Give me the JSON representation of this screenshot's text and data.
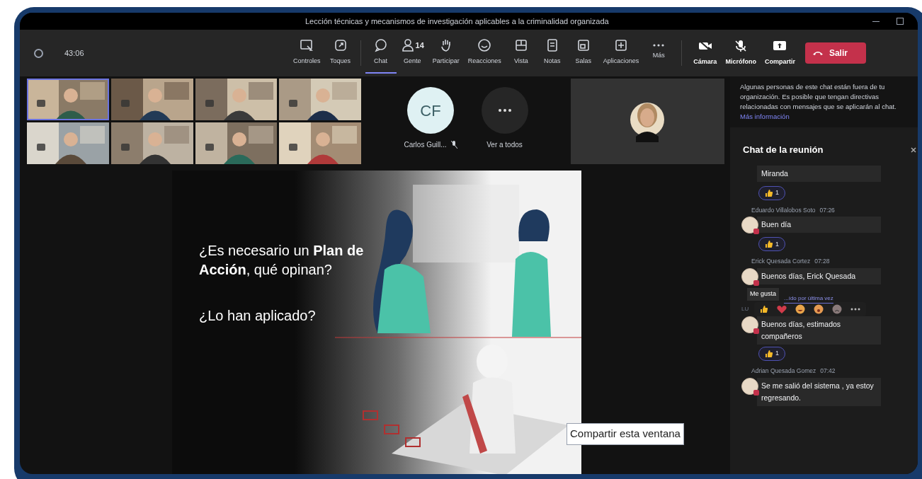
{
  "window": {
    "title": "Lección técnicas y mecanismos de investigación aplicables a la criminalidad organizada"
  },
  "toolbar": {
    "timer": "43:06",
    "items": [
      {
        "kind": "controls",
        "label": "Controles",
        "selected": false
      },
      {
        "kind": "toques",
        "label": "Toques",
        "selected": false
      },
      {
        "kind": "chat",
        "label": "Chat",
        "selected": true
      },
      {
        "kind": "people",
        "label": "Gente",
        "count": "14",
        "selected": false
      },
      {
        "kind": "hand",
        "label": "Participar",
        "selected": false
      },
      {
        "kind": "smile",
        "label": "Reacciones",
        "selected": false
      },
      {
        "kind": "view",
        "label": "Vista",
        "selected": false
      },
      {
        "kind": "notes",
        "label": "Notas",
        "selected": false
      },
      {
        "kind": "rooms",
        "label": "Salas",
        "selected": false
      },
      {
        "kind": "apps",
        "label": "Aplicaciones",
        "selected": false
      },
      {
        "kind": "more",
        "label": "Más",
        "selected": false
      }
    ],
    "devices": [
      {
        "kind": "camera",
        "label": "Cámara"
      },
      {
        "kind": "mic",
        "label": "Micrófono"
      },
      {
        "kind": "share",
        "label": "Compartir"
      }
    ],
    "leave": "Salir"
  },
  "video_tiles": [
    {
      "kind": "picture",
      "selected": true
    },
    {
      "kind": "picture",
      "selected": false
    },
    {
      "kind": "picture",
      "selected": false
    },
    {
      "kind": "picture",
      "selected": false
    },
    {
      "kind": "picture",
      "selected": false
    },
    {
      "kind": "picture",
      "selected": false
    },
    {
      "kind": "picture",
      "selected": false
    },
    {
      "kind": "picture",
      "selected": false
    }
  ],
  "participants": [
    {
      "kind": "avatar",
      "initials": "CF",
      "name": "Carlos Guill...",
      "muted": true
    },
    {
      "kind": "more",
      "label": "Ver a todos"
    }
  ],
  "slide": {
    "question": "¿Es necesario un **Plan de Acción**, qué opinan?",
    "question2": "¿Lo han aplicado?",
    "tooltip": "Compartir esta ventana"
  },
  "chat": {
    "notice": "Algunas personas de este chat están fuera de tu organización. Es posible que tengan directivas relacionadas con mensajes que se aplicarán al chat.",
    "notice_link": "Más información",
    "title": "Chat de la reunión",
    "messages": [
      {
        "text": "Miranda",
        "reaction": "1"
      },
      {
        "author": "Eduardo Villalobos Soto",
        "time": "07:26",
        "text": "Buen día",
        "reaction": "1"
      },
      {
        "author": "Erick Quesada Cortez",
        "time": "07:28",
        "text": "Buenos días, Erick Quesada",
        "hover": {
          "tooltip": "Me gusta",
          "seen": "...ído por última vez",
          "initials": "LU"
        }
      },
      {
        "text": "Buenos días, estimados compañeros",
        "reaction": "1"
      },
      {
        "author": "Adrian Quesada Gomez",
        "time": "07:42",
        "text": "Se me salió del sistema , ya estoy regresando."
      }
    ]
  }
}
